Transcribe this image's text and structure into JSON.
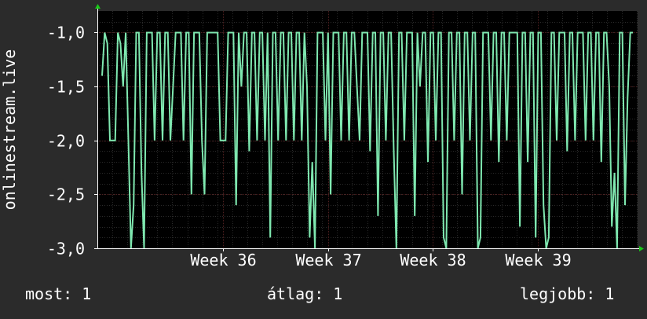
{
  "colors": {
    "background": "#2b2b2b",
    "plot_background": "#000000",
    "grid_major": "#4d1f1f",
    "grid_minor": "#2a2a2a",
    "series": "#7fe8b0",
    "axis": "#ffffff",
    "arrow": "#19c819",
    "text": "#ffffff"
  },
  "legend": {
    "current": "most: 1",
    "average": "átlag: 1",
    "max": "legjobb: 1"
  },
  "chart_data": {
    "type": "line",
    "ylabel": "onlinestream.live",
    "ylim": [
      -3.0,
      -0.8
    ],
    "yticks": [
      -1.0,
      -1.5,
      -2.0,
      -2.5,
      -3.0
    ],
    "ytick_labels": [
      "-1,0",
      "-1,5",
      "-2,0",
      "-2,5",
      "-3,0"
    ],
    "xlim": [
      34.8,
      39.95
    ],
    "xticks": [
      36,
      37,
      38,
      39
    ],
    "xtick_labels": [
      "Week 36",
      "Week 37",
      "Week 38",
      "Week 39"
    ],
    "grid": true,
    "series": [
      {
        "values": [
          -1.4,
          -1.0,
          -1.1,
          -2.0,
          -2.0,
          -2.0,
          -1.0,
          -1.1,
          -1.5,
          -1.0,
          -2.0,
          -3.0,
          -2.6,
          -1.0,
          -1.0,
          -2.3,
          -3.0,
          -1.0,
          -1.0,
          -1.0,
          -2.0,
          -1.0,
          -1.0,
          -2.0,
          -1.0,
          -1.0,
          -2.0,
          -1.5,
          -1.0,
          -1.0,
          -1.0,
          -2.0,
          -1.0,
          -1.0,
          -2.5,
          -1.0,
          -1.0,
          -1.0,
          -2.0,
          -2.5,
          -1.0,
          -1.0,
          -1.0,
          -1.0,
          -1.0,
          -2.0,
          -2.0,
          -2.0,
          -1.0,
          -1.0,
          -1.0,
          -2.6,
          -1.0,
          -1.5,
          -1.0,
          -1.0,
          -2.1,
          -1.0,
          -1.0,
          -2.0,
          -1.0,
          -1.0,
          -2.0,
          -1.0,
          -2.9,
          -1.0,
          -1.0,
          -2.0,
          -1.0,
          -1.0,
          -2.0,
          -1.0,
          -1.0,
          -2.0,
          -1.0,
          -1.0,
          -2.0,
          -1.0,
          -1.5,
          -2.9,
          -2.2,
          -3.0,
          -1.0,
          -1.0,
          -1.0,
          -2.0,
          -1.0,
          -2.5,
          -1.0,
          -1.0,
          -1.0,
          -2.0,
          -1.0,
          -1.0,
          -2.0,
          -1.0,
          -1.0,
          -1.5,
          -2.0,
          -1.0,
          -1.0,
          -1.0,
          -2.1,
          -1.0,
          -1.0,
          -2.7,
          -1.0,
          -1.0,
          -2.0,
          -1.0,
          -1.0,
          -2.1,
          -3.0,
          -1.0,
          -1.0,
          -2.0,
          -1.0,
          -1.0,
          -1.0,
          -2.7,
          -1.0,
          -1.5,
          -1.0,
          -1.0,
          -2.2,
          -1.0,
          -1.0,
          -2.0,
          -1.0,
          -1.0,
          -2.9,
          -3.0,
          -1.0,
          -1.0,
          -2.0,
          -1.0,
          -1.0,
          -2.5,
          -1.0,
          -1.0,
          -2.0,
          -1.0,
          -1.0,
          -3.0,
          -2.9,
          -1.0,
          -1.0,
          -1.0,
          -2.0,
          -1.0,
          -1.0,
          -2.2,
          -1.0,
          -1.0,
          -2.0,
          -1.0,
          -1.0,
          -1.0,
          -1.0,
          -2.8,
          -1.0,
          -1.0,
          -2.2,
          -1.0,
          -1.0,
          -2.9,
          -1.0,
          -1.0,
          -2.6,
          -3.0,
          -2.9,
          -1.0,
          -1.0,
          -2.0,
          -1.0,
          -1.0,
          -1.0,
          -2.1,
          -1.0,
          -1.0,
          -2.0,
          -1.0,
          -1.0,
          -1.0,
          -2.0,
          -1.0,
          -1.0,
          -2.0,
          -1.0,
          -1.0,
          -2.2,
          -1.0,
          -1.0,
          -1.5,
          -2.8,
          -2.3,
          -3.0,
          -1.0,
          -1.0,
          -2.6,
          -1.6,
          -1.0,
          -1.0
        ]
      }
    ]
  }
}
